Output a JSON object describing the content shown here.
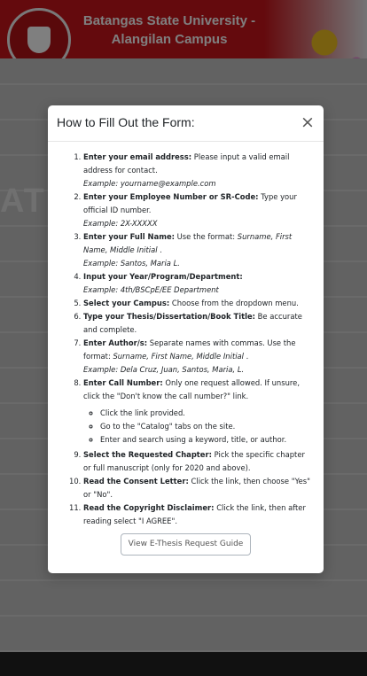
{
  "background": {
    "university_line1": "Batangas State University -",
    "university_line2": "Alangilan Campus",
    "faded_text": "ATIO"
  },
  "modal": {
    "title": "How to Fill Out the Form:",
    "close_icon": "×",
    "steps": [
      {
        "label": "Enter your email address:",
        "text": " Please input a valid email address for contact.",
        "example": "Example: yourname@example.com"
      },
      {
        "label": "Enter your Employee Number or SR-Code:",
        "text": " Type your official ID number.",
        "example": "Example: 2X-XXXXX"
      },
      {
        "label": "Enter your Full Name:",
        "text": " Use the format: ",
        "text_italic": "Surname, First Name, Middle Initial",
        "text_tail": " .",
        "example": "Example: Santos, Maria L."
      },
      {
        "label": "Input your Year/Program/Department:",
        "example": "Example: 4th/BSCpE/EE Department"
      },
      {
        "label": "Select your Campus:",
        "text": " Choose from the dropdown menu."
      },
      {
        "label": "Type your Thesis/Dissertation/Book Title:",
        "text": " Be accurate and complete."
      },
      {
        "label": "Enter Author/s:",
        "text": " Separate names with commas. Use the format: ",
        "text_italic": "Surname, First Name, Middle Initial",
        "text_tail": " .",
        "example": "Example: Dela Cruz, Juan, Santos, Maria, L."
      },
      {
        "label": "Enter Call Number:",
        "text": " Only one request allowed. If unsure, click the \"Don't know the call number?\" link.",
        "sub": [
          "Click the link provided.",
          "Go to the \"Catalog\" tabs on the site.",
          "Enter and search using a keyword, title, or author."
        ]
      },
      {
        "label": "Select the Requested Chapter:",
        "text": " Pick the specific chapter or full manuscript (only for 2020 and above)."
      },
      {
        "label": "Read the Consent Letter:",
        "text": " Click the link, then choose \"Yes\" or \"No\"."
      },
      {
        "label": "Read the Copyright Disclaimer:",
        "text": " Click the link, then after reading select \"I AGREE\"."
      }
    ],
    "guide_button": "View E-Thesis Request Guide"
  }
}
